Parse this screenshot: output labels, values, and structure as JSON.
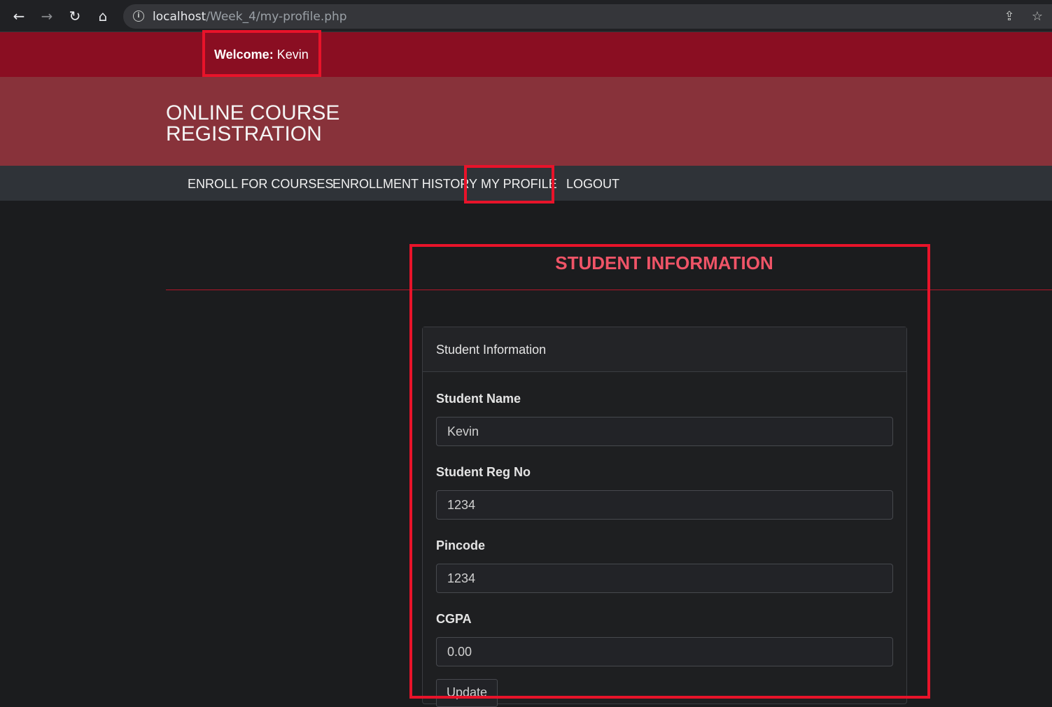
{
  "browser": {
    "back_icon": "←",
    "forward_icon": "→",
    "reload_icon": "↻",
    "home_icon": "⌂",
    "info_icon": "i",
    "url_host": "localhost",
    "url_path": "/Week_4/my-profile.php",
    "share_icon": "⇪",
    "star_icon": "☆"
  },
  "welcome": {
    "label": "Welcome:",
    "name": " Kevin"
  },
  "header": {
    "title": "ONLINE COURSE REGISTRATION"
  },
  "nav": {
    "items": [
      {
        "label": "ENROLL FOR COURSES"
      },
      {
        "label": "ENROLLMENT HISTORY"
      },
      {
        "label": "MY PROFILE"
      },
      {
        "label": "LOGOUT"
      }
    ]
  },
  "main": {
    "heading": "STUDENT INFORMATION",
    "card_title": "Student Information",
    "fields": [
      {
        "label": "Student Name",
        "value": "Kevin"
      },
      {
        "label": "Student Reg No",
        "value": "1234"
      },
      {
        "label": "Pincode",
        "value": "1234"
      },
      {
        "label": "CGPA",
        "value": "0.00"
      }
    ],
    "update_label": "Update"
  },
  "colors": {
    "welcome_bar": "#8a0e22",
    "header": "#88323a",
    "navbar": "#2f3338",
    "highlight": "#e8132a",
    "heading": "#ef5467"
  }
}
